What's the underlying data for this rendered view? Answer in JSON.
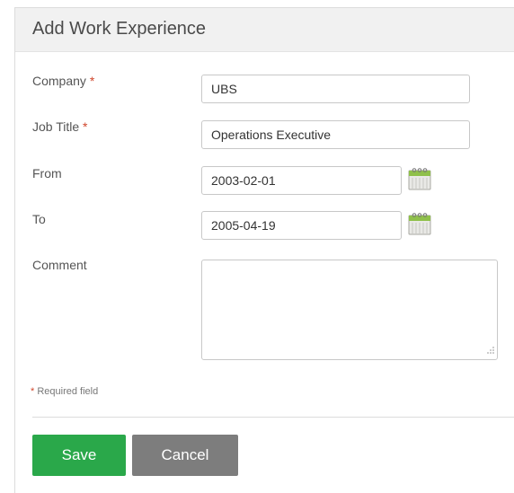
{
  "dialog": {
    "title": "Add Work Experience"
  },
  "form": {
    "required_marker": "*",
    "company": {
      "label": "Company",
      "value": "UBS"
    },
    "job_title": {
      "label": "Job Title",
      "value": "Operations Executive"
    },
    "from": {
      "label": "From",
      "value": "2003-02-01"
    },
    "to": {
      "label": "To",
      "value": "2005-04-19"
    },
    "comment": {
      "label": "Comment",
      "value": ""
    },
    "required_note_text": "Required field"
  },
  "actions": {
    "save_label": "Save",
    "cancel_label": "Cancel"
  },
  "icons": {
    "date_picker": "calendar-icon",
    "resize": "resize-grip-icon"
  },
  "colors": {
    "save": "#2aa84a",
    "cancel": "#7d7d7d",
    "required": "#d0462c",
    "header_bg": "#f1f1f1"
  }
}
